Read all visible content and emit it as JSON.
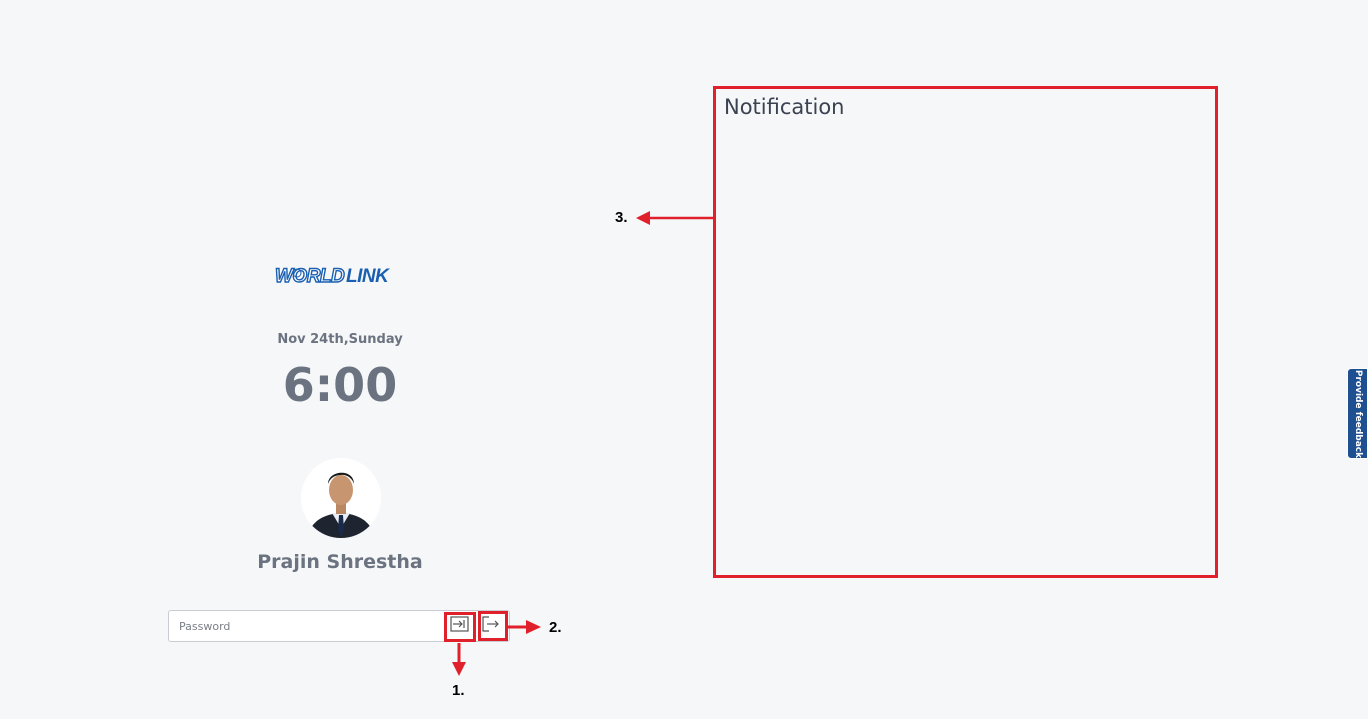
{
  "logo_text": "WORLDLINK",
  "lock": {
    "date": "Nov 24th,Sunday",
    "time": "6:00",
    "user_name": "Prajin Shrestha"
  },
  "password": {
    "placeholder": "Password"
  },
  "notification": {
    "title": "Notification"
  },
  "annotations": {
    "label_1": "1.",
    "label_2": "2.",
    "label_3": "3."
  },
  "feedback_tab": {
    "label": "Provide feedback"
  },
  "icons": {
    "login": "login-icon",
    "logout": "logout-icon"
  },
  "colors": {
    "annotation_red": "#e0202a",
    "brand_blue": "#1a5fb0",
    "feedback_blue": "#1d4f91"
  }
}
